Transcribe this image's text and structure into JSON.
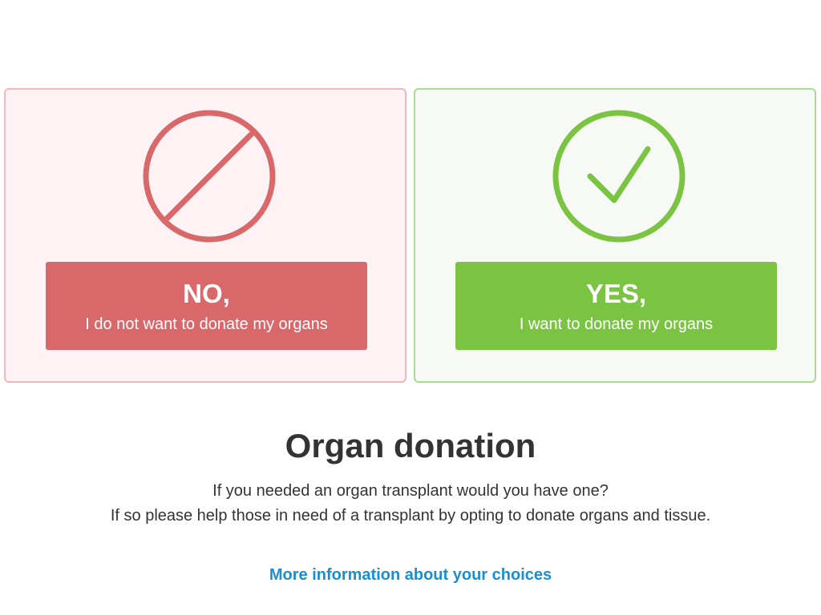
{
  "choices": {
    "no": {
      "title": "NO,",
      "subtitle": "I do not want to donate my organs",
      "icon": "prohibited-icon",
      "color": "#d9686a"
    },
    "yes": {
      "title": "YES,",
      "subtitle": "I want to donate my organs",
      "icon": "checkmark-circle-icon",
      "color": "#7bc443"
    }
  },
  "main": {
    "title": "Organ donation",
    "line1": "If you needed an organ transplant would you have one?",
    "line2": "If so please help those in need of a transplant by opting to donate organs and tissue.",
    "link": "More information about your choices",
    "link_color": "#1a8fd0"
  }
}
